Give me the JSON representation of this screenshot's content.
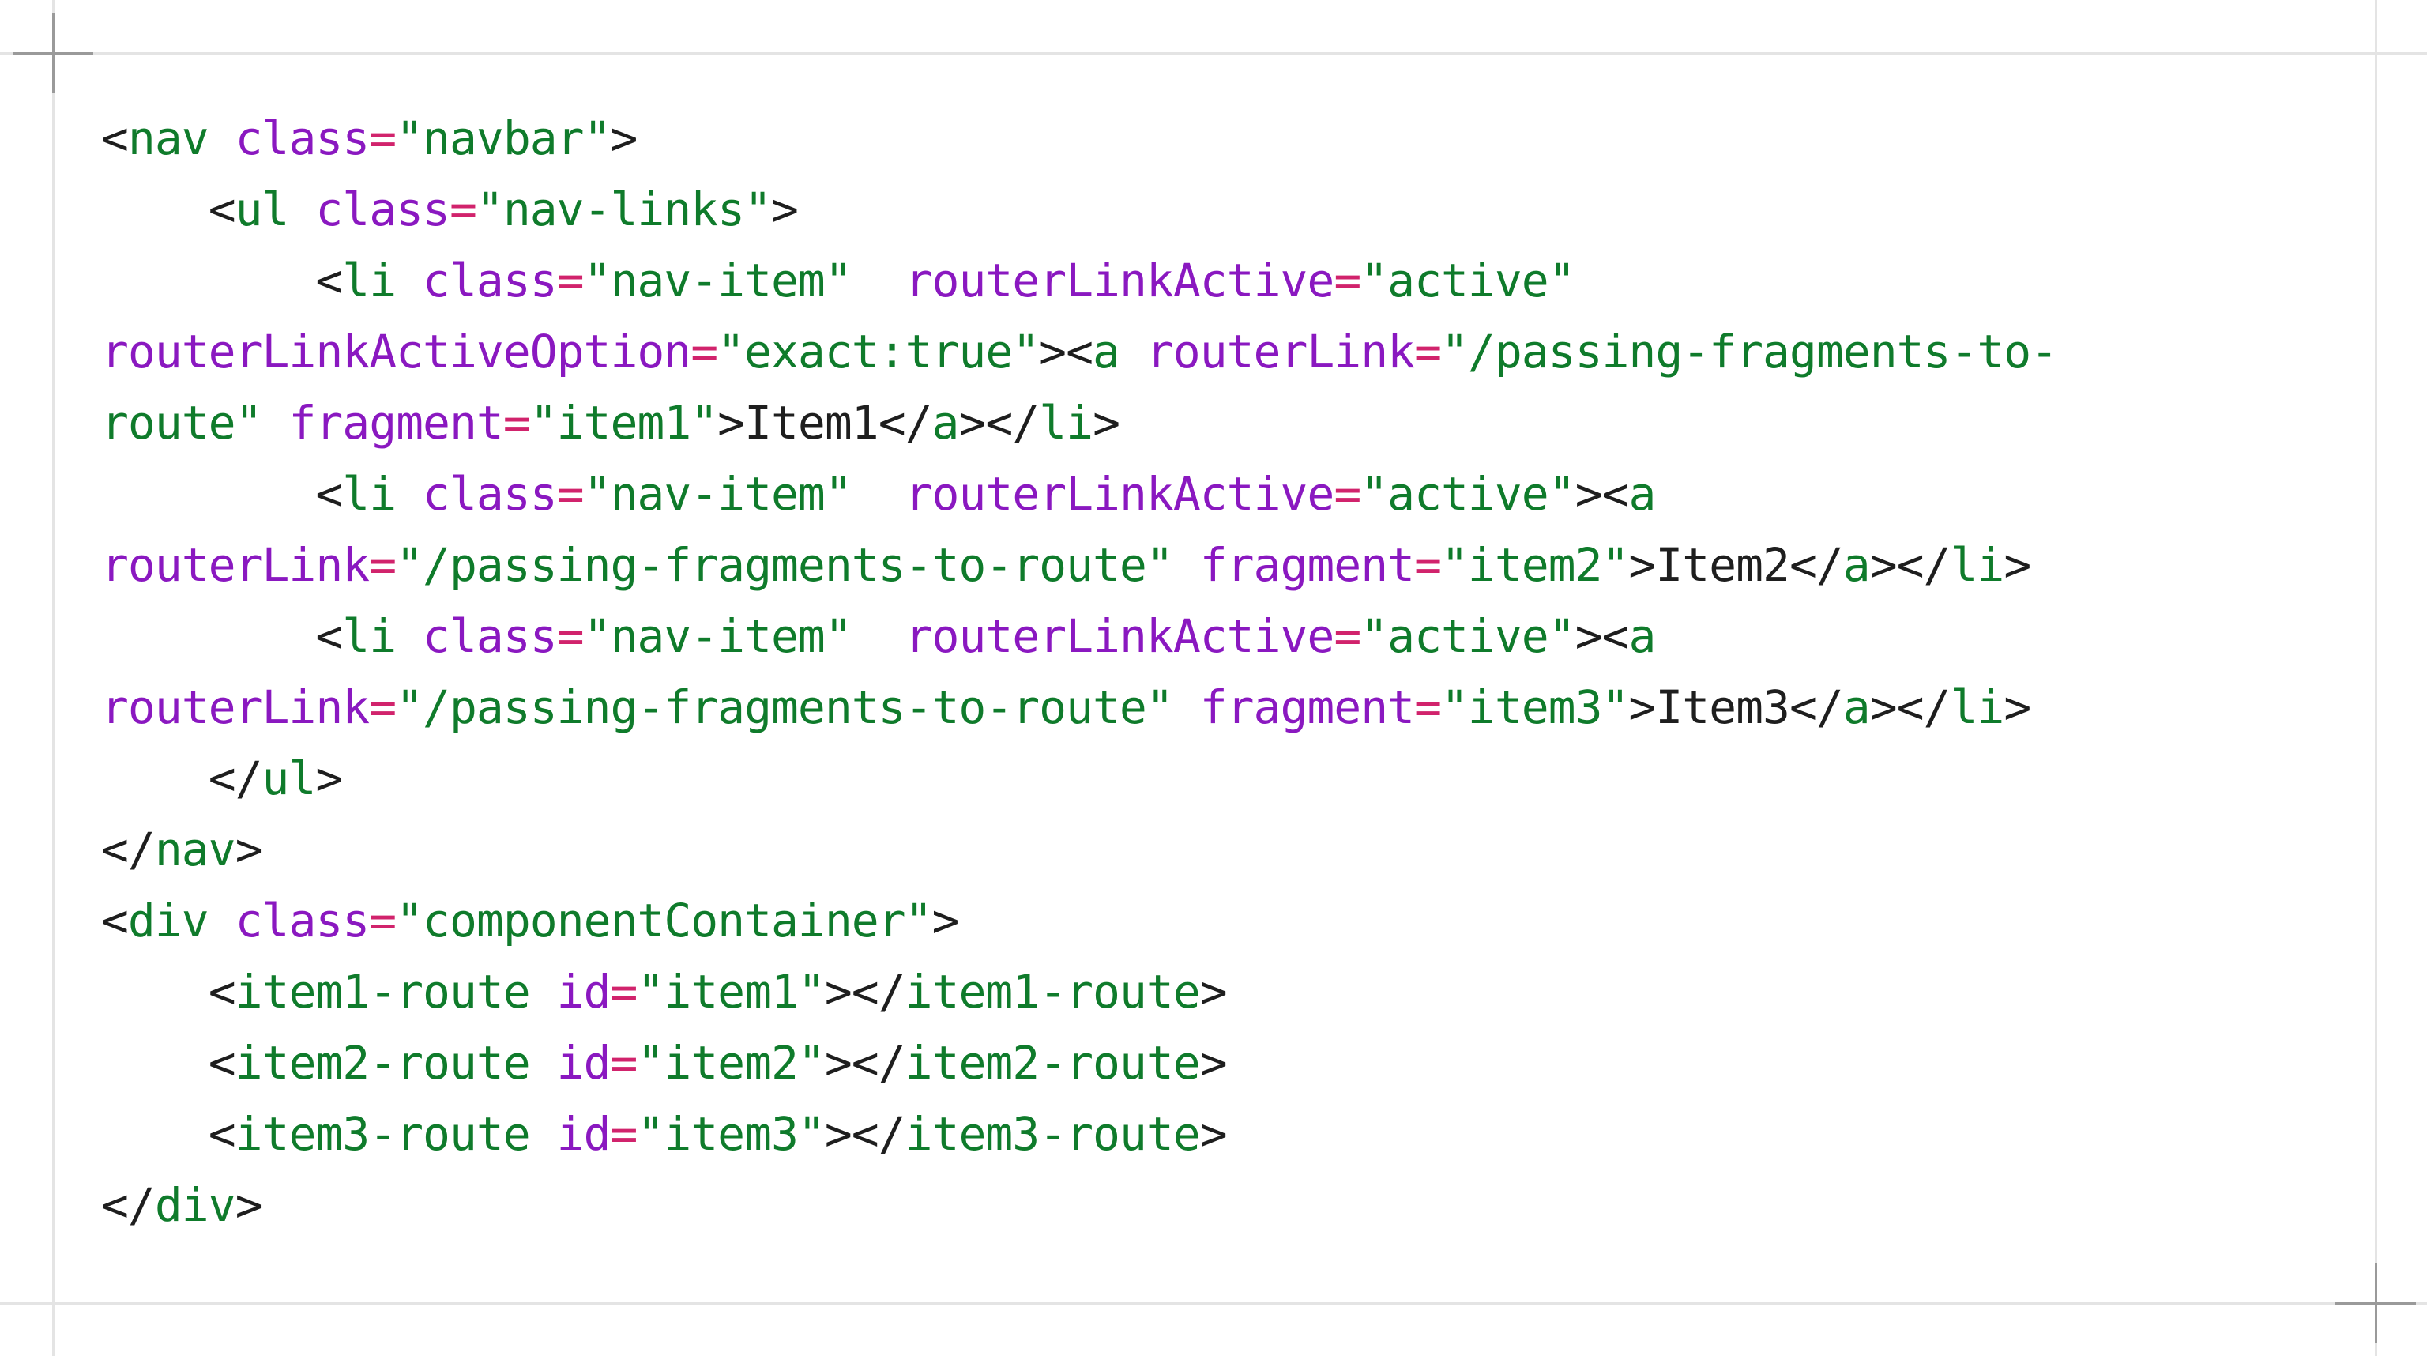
{
  "colors": {
    "tag": "#0f7b2b",
    "punctuation": "#1e1e1e",
    "attribute": "#8a18c0",
    "equals": "#d1236c",
    "string": "#0f7b2b",
    "text": "#1e1e1e"
  },
  "code_lines": [
    [
      [
        "punct",
        "<"
      ],
      [
        "tag",
        "nav"
      ],
      [
        "text",
        " "
      ],
      [
        "attr",
        "class"
      ],
      [
        "eq",
        "="
      ],
      [
        "str",
        "\"navbar\""
      ],
      [
        "punct",
        ">"
      ]
    ],
    [
      [
        "text",
        "    "
      ],
      [
        "punct",
        "<"
      ],
      [
        "tag",
        "ul"
      ],
      [
        "text",
        " "
      ],
      [
        "attr",
        "class"
      ],
      [
        "eq",
        "="
      ],
      [
        "str",
        "\"nav-links\""
      ],
      [
        "punct",
        ">"
      ]
    ],
    [
      [
        "text",
        "        "
      ],
      [
        "punct",
        "<"
      ],
      [
        "tag",
        "li"
      ],
      [
        "text",
        " "
      ],
      [
        "attr",
        "class"
      ],
      [
        "eq",
        "="
      ],
      [
        "str",
        "\"nav-item\""
      ],
      [
        "text",
        "  "
      ],
      [
        "attr",
        "routerLinkActive"
      ],
      [
        "eq",
        "="
      ],
      [
        "str",
        "\"active\""
      ]
    ],
    [
      [
        "attr",
        "routerLinkActiveOption"
      ],
      [
        "eq",
        "="
      ],
      [
        "str",
        "\"exact:true\""
      ],
      [
        "punct",
        "><"
      ],
      [
        "tag",
        "a"
      ],
      [
        "text",
        " "
      ],
      [
        "attr",
        "routerLink"
      ],
      [
        "eq",
        "="
      ],
      [
        "str",
        "\"/passing-fragments-to-"
      ]
    ],
    [
      [
        "str",
        "route\""
      ],
      [
        "text",
        " "
      ],
      [
        "attr",
        "fragment"
      ],
      [
        "eq",
        "="
      ],
      [
        "str",
        "\"item1\""
      ],
      [
        "punct",
        ">"
      ],
      [
        "text",
        "Item1"
      ],
      [
        "punct",
        "</"
      ],
      [
        "tag",
        "a"
      ],
      [
        "punct",
        "></"
      ],
      [
        "tag",
        "li"
      ],
      [
        "punct",
        ">"
      ]
    ],
    [
      [
        "text",
        "        "
      ],
      [
        "punct",
        "<"
      ],
      [
        "tag",
        "li"
      ],
      [
        "text",
        " "
      ],
      [
        "attr",
        "class"
      ],
      [
        "eq",
        "="
      ],
      [
        "str",
        "\"nav-item\""
      ],
      [
        "text",
        "  "
      ],
      [
        "attr",
        "routerLinkActive"
      ],
      [
        "eq",
        "="
      ],
      [
        "str",
        "\"active\""
      ],
      [
        "punct",
        "><"
      ],
      [
        "tag",
        "a"
      ]
    ],
    [
      [
        "attr",
        "routerLink"
      ],
      [
        "eq",
        "="
      ],
      [
        "str",
        "\"/passing-fragments-to-route\""
      ],
      [
        "text",
        " "
      ],
      [
        "attr",
        "fragment"
      ],
      [
        "eq",
        "="
      ],
      [
        "str",
        "\"item2\""
      ],
      [
        "punct",
        ">"
      ],
      [
        "text",
        "Item2"
      ],
      [
        "punct",
        "</"
      ],
      [
        "tag",
        "a"
      ],
      [
        "punct",
        "></"
      ],
      [
        "tag",
        "li"
      ],
      [
        "punct",
        ">"
      ]
    ],
    [
      [
        "text",
        "        "
      ],
      [
        "punct",
        "<"
      ],
      [
        "tag",
        "li"
      ],
      [
        "text",
        " "
      ],
      [
        "attr",
        "class"
      ],
      [
        "eq",
        "="
      ],
      [
        "str",
        "\"nav-item\""
      ],
      [
        "text",
        "  "
      ],
      [
        "attr",
        "routerLinkActive"
      ],
      [
        "eq",
        "="
      ],
      [
        "str",
        "\"active\""
      ],
      [
        "punct",
        "><"
      ],
      [
        "tag",
        "a"
      ]
    ],
    [
      [
        "attr",
        "routerLink"
      ],
      [
        "eq",
        "="
      ],
      [
        "str",
        "\"/passing-fragments-to-route\""
      ],
      [
        "text",
        " "
      ],
      [
        "attr",
        "fragment"
      ],
      [
        "eq",
        "="
      ],
      [
        "str",
        "\"item3\""
      ],
      [
        "punct",
        ">"
      ],
      [
        "text",
        "Item3"
      ],
      [
        "punct",
        "</"
      ],
      [
        "tag",
        "a"
      ],
      [
        "punct",
        "></"
      ],
      [
        "tag",
        "li"
      ],
      [
        "punct",
        ">"
      ]
    ],
    [
      [
        "text",
        "    "
      ],
      [
        "punct",
        "</"
      ],
      [
        "tag",
        "ul"
      ],
      [
        "punct",
        ">"
      ]
    ],
    [
      [
        "punct",
        "</"
      ],
      [
        "tag",
        "nav"
      ],
      [
        "punct",
        ">"
      ]
    ],
    [
      [
        "punct",
        "<"
      ],
      [
        "tag",
        "div"
      ],
      [
        "text",
        " "
      ],
      [
        "attr",
        "class"
      ],
      [
        "eq",
        "="
      ],
      [
        "str",
        "\"componentContainer\""
      ],
      [
        "punct",
        ">"
      ]
    ],
    [
      [
        "text",
        "    "
      ],
      [
        "punct",
        "<"
      ],
      [
        "tag",
        "item1-route"
      ],
      [
        "text",
        " "
      ],
      [
        "attr",
        "id"
      ],
      [
        "eq",
        "="
      ],
      [
        "str",
        "\"item1\""
      ],
      [
        "punct",
        "></"
      ],
      [
        "tag",
        "item1-route"
      ],
      [
        "punct",
        ">"
      ]
    ],
    [
      [
        "text",
        "    "
      ],
      [
        "punct",
        "<"
      ],
      [
        "tag",
        "item2-route"
      ],
      [
        "text",
        " "
      ],
      [
        "attr",
        "id"
      ],
      [
        "eq",
        "="
      ],
      [
        "str",
        "\"item2\""
      ],
      [
        "punct",
        "></"
      ],
      [
        "tag",
        "item2-route"
      ],
      [
        "punct",
        ">"
      ]
    ],
    [
      [
        "text",
        "    "
      ],
      [
        "punct",
        "<"
      ],
      [
        "tag",
        "item3-route"
      ],
      [
        "text",
        " "
      ],
      [
        "attr",
        "id"
      ],
      [
        "eq",
        "="
      ],
      [
        "str",
        "\"item3\""
      ],
      [
        "punct",
        "></"
      ],
      [
        "tag",
        "item3-route"
      ],
      [
        "punct",
        ">"
      ]
    ],
    [
      [
        "punct",
        "</"
      ],
      [
        "tag",
        "div"
      ],
      [
        "punct",
        ">"
      ]
    ]
  ]
}
